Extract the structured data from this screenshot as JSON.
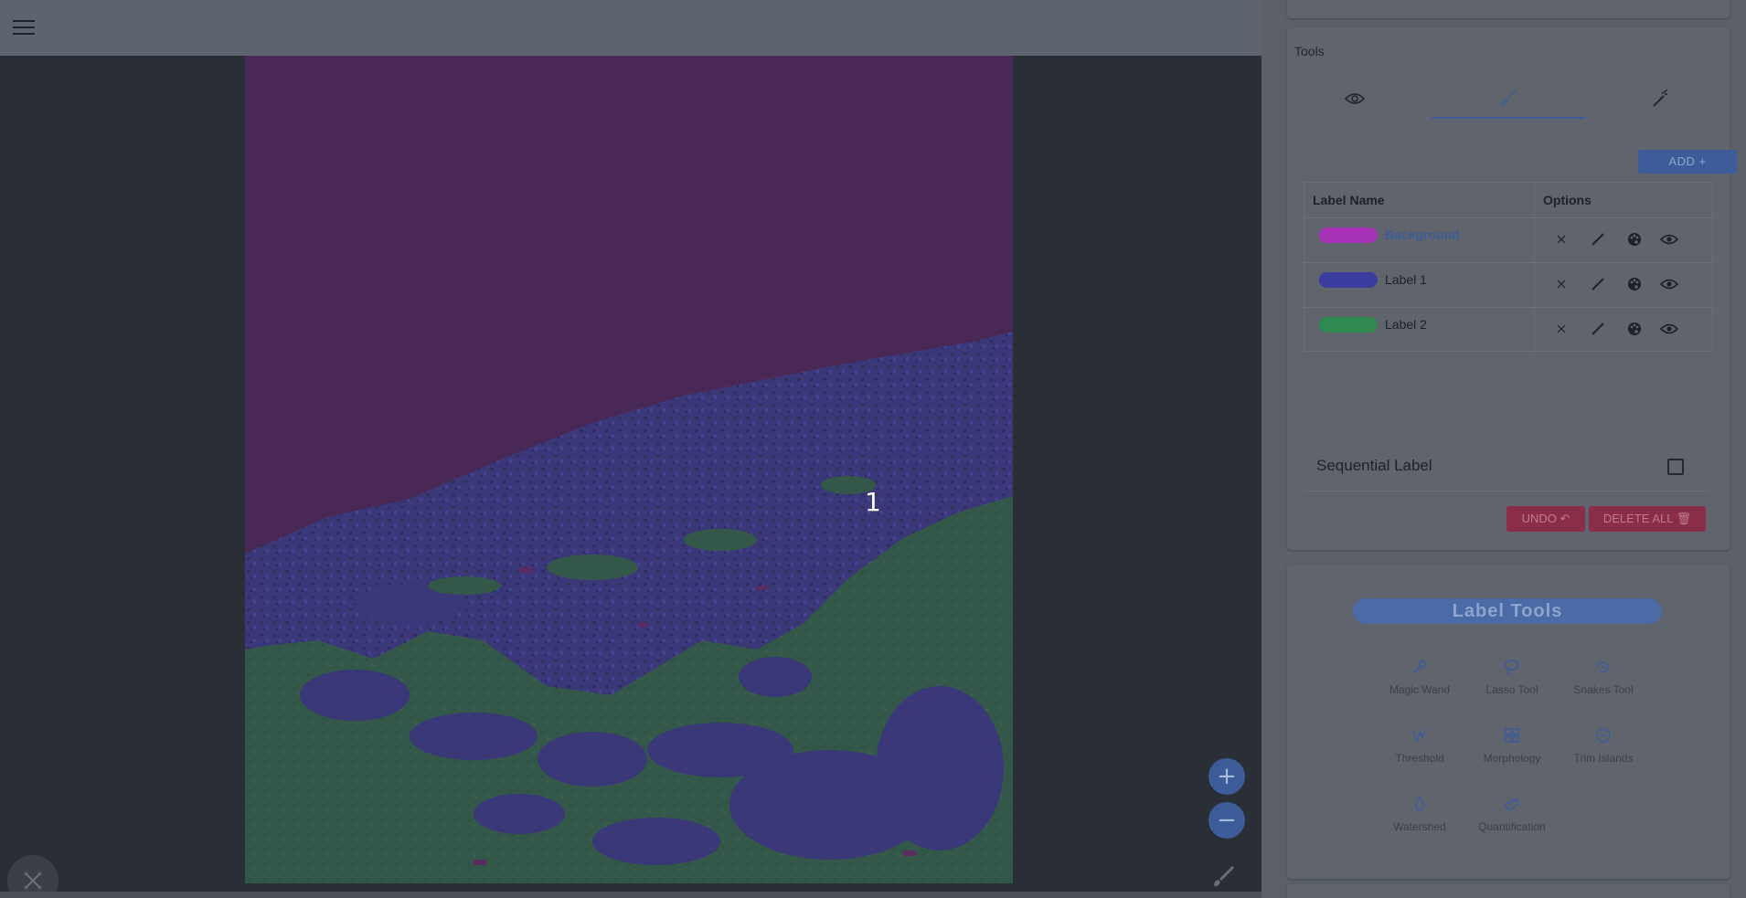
{
  "topbar": {
    "menu_icon": "hamburger-menu-icon"
  },
  "viewer": {
    "overlay_label": "1",
    "zoom_in_label": "+",
    "zoom_out_label": "−",
    "colors": {
      "background": "#4a2856",
      "label1": "#3a3878",
      "label2": "#33584a"
    }
  },
  "panel": {
    "tools_heading": "Tools",
    "tabs": [
      {
        "icon": "eye-icon"
      },
      {
        "icon": "brush-icon",
        "active": true
      },
      {
        "icon": "magic-wand-icon"
      }
    ],
    "add_button": "ADD +",
    "table": {
      "col_name": "Label Name",
      "col_options": "Options",
      "rows": [
        {
          "name": "Background",
          "color": "#a833b8",
          "active": true
        },
        {
          "name": "Label 1",
          "color": "#3a3ca0",
          "active": false
        },
        {
          "name": "Label 2",
          "color": "#2f8a4f",
          "active": false
        }
      ]
    },
    "sequential_label": "Sequential Label",
    "undo_button": "UNDO ↶",
    "delete_all_button": "DELETE ALL 🗑"
  },
  "label_tools": {
    "title": "Label Tools",
    "tools": [
      {
        "name": "Magic Wand",
        "icon": "magic-wand-icon"
      },
      {
        "name": "Lasso Tool",
        "icon": "lasso-icon"
      },
      {
        "name": "Snakes Tool",
        "icon": "snakes-icon"
      },
      {
        "name": "Threshold",
        "icon": "threshold-icon"
      },
      {
        "name": "Morphology",
        "icon": "morphology-icon"
      },
      {
        "name": "Trim Islands",
        "icon": "trim-islands-icon"
      },
      {
        "name": "Watershed",
        "icon": "watershed-icon"
      },
      {
        "name": "Quantification",
        "icon": "quantification-icon"
      }
    ]
  }
}
